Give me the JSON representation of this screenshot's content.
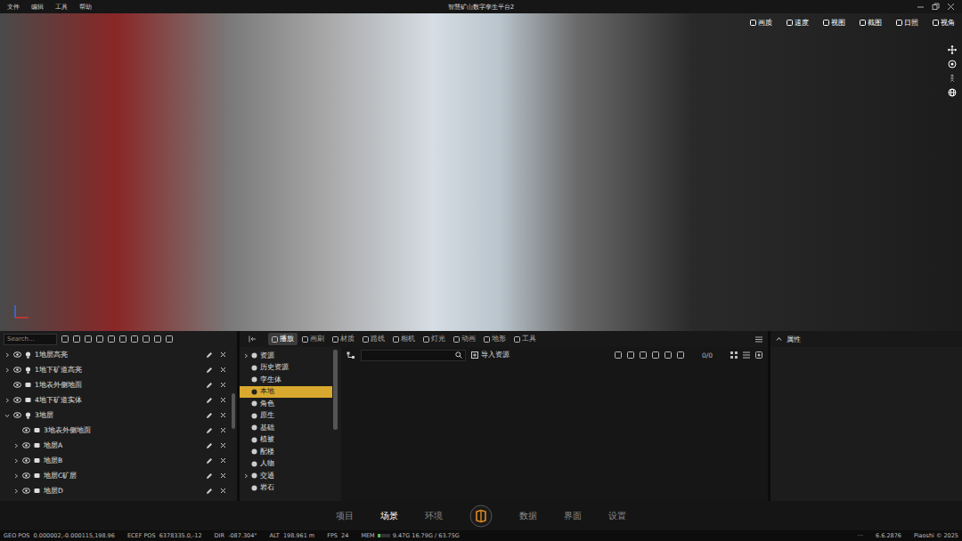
{
  "menu": [
    "文件",
    "编辑",
    "工具",
    "帮助"
  ],
  "window": {
    "title": "智慧矿山数字孪生平台2"
  },
  "viewport_toolbar": [
    {
      "label": "画质"
    },
    {
      "label": "速度"
    },
    {
      "label": "视图"
    },
    {
      "label": "截图"
    },
    {
      "label": "日照"
    },
    {
      "label": "视角"
    }
  ],
  "outliner": {
    "search_placeholder": "Search...",
    "rows": [
      {
        "name": "1地层高亮",
        "kind": "light",
        "depth": 0,
        "expandable": true,
        "expanded": false,
        "visible": true
      },
      {
        "name": "1地下矿道高亮",
        "kind": "light",
        "depth": 0,
        "expandable": true,
        "expanded": false,
        "visible": true
      },
      {
        "name": "1地表外侧地面",
        "kind": "mesh",
        "depth": 0,
        "expandable": false,
        "expanded": false,
        "visible": true
      },
      {
        "name": "4地下矿道实体",
        "kind": "mesh",
        "depth": 0,
        "expandable": true,
        "expanded": false,
        "visible": true
      },
      {
        "name": "3地层",
        "kind": "light",
        "depth": 0,
        "expandable": true,
        "expanded": true,
        "visible": true
      },
      {
        "name": "3地表外侧地面",
        "kind": "mesh",
        "depth": 1,
        "expandable": false,
        "expanded": false,
        "visible": true
      },
      {
        "name": "地层A",
        "kind": "mesh",
        "depth": 1,
        "expandable": true,
        "expanded": false,
        "visible": true
      },
      {
        "name": "地层B",
        "kind": "mesh",
        "depth": 1,
        "expandable": true,
        "expanded": false,
        "visible": true
      },
      {
        "name": "地层C矿层",
        "kind": "mesh",
        "depth": 1,
        "expandable": true,
        "expanded": false,
        "visible": true
      },
      {
        "name": "地层D",
        "kind": "mesh",
        "depth": 1,
        "expandable": true,
        "expanded": false,
        "visible": true
      }
    ]
  },
  "asset_browser": {
    "tabs": [
      {
        "label": "播放",
        "selected": true
      },
      {
        "label": "画刷",
        "selected": false
      },
      {
        "label": "材质",
        "selected": false
      },
      {
        "label": "路线",
        "selected": false
      },
      {
        "label": "相机",
        "selected": false
      },
      {
        "label": "灯光",
        "selected": false
      },
      {
        "label": "动画",
        "selected": false
      },
      {
        "label": "地形",
        "selected": false
      },
      {
        "label": "工具",
        "selected": false
      }
    ],
    "categories": [
      {
        "label": "资源",
        "expandable": true,
        "selected": false
      },
      {
        "label": "历史资源",
        "expandable": false,
        "selected": false
      },
      {
        "label": "孪生体",
        "expandable": false,
        "selected": false
      },
      {
        "label": "本地",
        "expandable": false,
        "selected": true
      },
      {
        "label": "角色",
        "expandable": false,
        "selected": false
      },
      {
        "label": "原生",
        "expandable": false,
        "selected": false
      },
      {
        "label": "基础",
        "expandable": false,
        "selected": false
      },
      {
        "label": "植被",
        "expandable": false,
        "selected": false
      },
      {
        "label": "配楼",
        "expandable": false,
        "selected": false
      },
      {
        "label": "人物",
        "expandable": false,
        "selected": false
      },
      {
        "label": "交通",
        "expandable": true,
        "selected": false
      },
      {
        "label": "岩石",
        "expandable": false,
        "selected": false
      }
    ],
    "import_button": "导入资源",
    "count": "0/0"
  },
  "properties": {
    "title": "属性"
  },
  "nav_left": [
    {
      "label": "项目",
      "selected": false
    },
    {
      "label": "场景",
      "selected": true
    },
    {
      "label": "环境",
      "selected": false
    }
  ],
  "nav_right": [
    {
      "label": "数据",
      "selected": false
    },
    {
      "label": "界面",
      "selected": false
    },
    {
      "label": "设置",
      "selected": false
    }
  ],
  "status_bar": {
    "items": [
      {
        "label": "GEO POS",
        "value": "0.000002,-0.000115,198.96"
      },
      {
        "label": "ECEF POS",
        "value": "6378335.0,-12"
      },
      {
        "label": "DIR",
        "value": "-087.304°"
      },
      {
        "label": "ALT",
        "value": "198.961 m"
      },
      {
        "label": "FPS",
        "value": "24"
      }
    ],
    "memory": {
      "label": "MEM",
      "value": "9.47G 16.79G / 63.75G",
      "level": 0.26
    },
    "more": "···",
    "version": "6.6.2876",
    "copyright": "Piaoshi © 2025"
  }
}
